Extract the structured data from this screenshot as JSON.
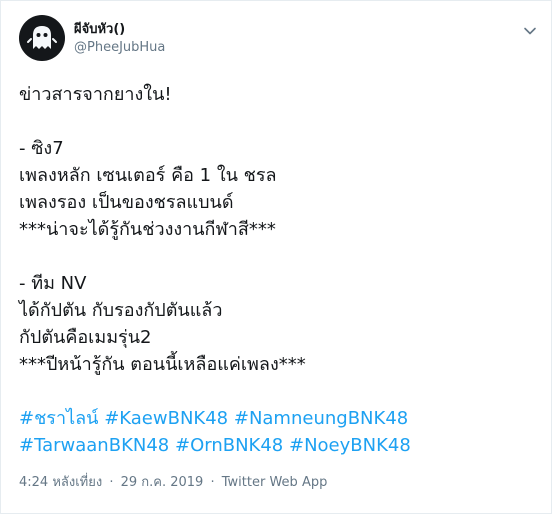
{
  "author": {
    "display_name": "ผีจับหัว()",
    "handle": "@PheeJubHua",
    "avatar_icon": "ghost-icon"
  },
  "tweet": {
    "lines": [
      "ข่าวสารจากยางใน!",
      "",
      "- ซิง7",
      "เพลงหลัก เซนเตอร์ คือ 1 ใน ชรล",
      "เพลงรอง เป็นของชรลแบนด์",
      "***น่าจะได้รู้กันช่วงงานกีฬาสี***",
      "",
      "- ทีม NV",
      "ได้กัปตัน กับรองกัปตันแล้ว",
      "กัปตันคือเมมรุ่น2",
      "***ปีหน้ารู้กัน ตอนนี้เหลือแค่เพลง***"
    ],
    "hashtags_row1": [
      "#ชราไลน์",
      "#KaewBNK48",
      "#NamneungBNK48"
    ],
    "hashtags_row2": [
      "#TarwaanBKN48",
      "#OrnBNK48",
      "#NoeyBNK48"
    ]
  },
  "meta": {
    "time": "4:24 หลังเที่ยง",
    "separator": "·",
    "date": "29 ก.ค. 2019",
    "source": "Twitter Web App"
  },
  "colors": {
    "link": "#1da1f2",
    "text": "#14171a",
    "muted": "#657786",
    "border": "#e6ecf0"
  }
}
